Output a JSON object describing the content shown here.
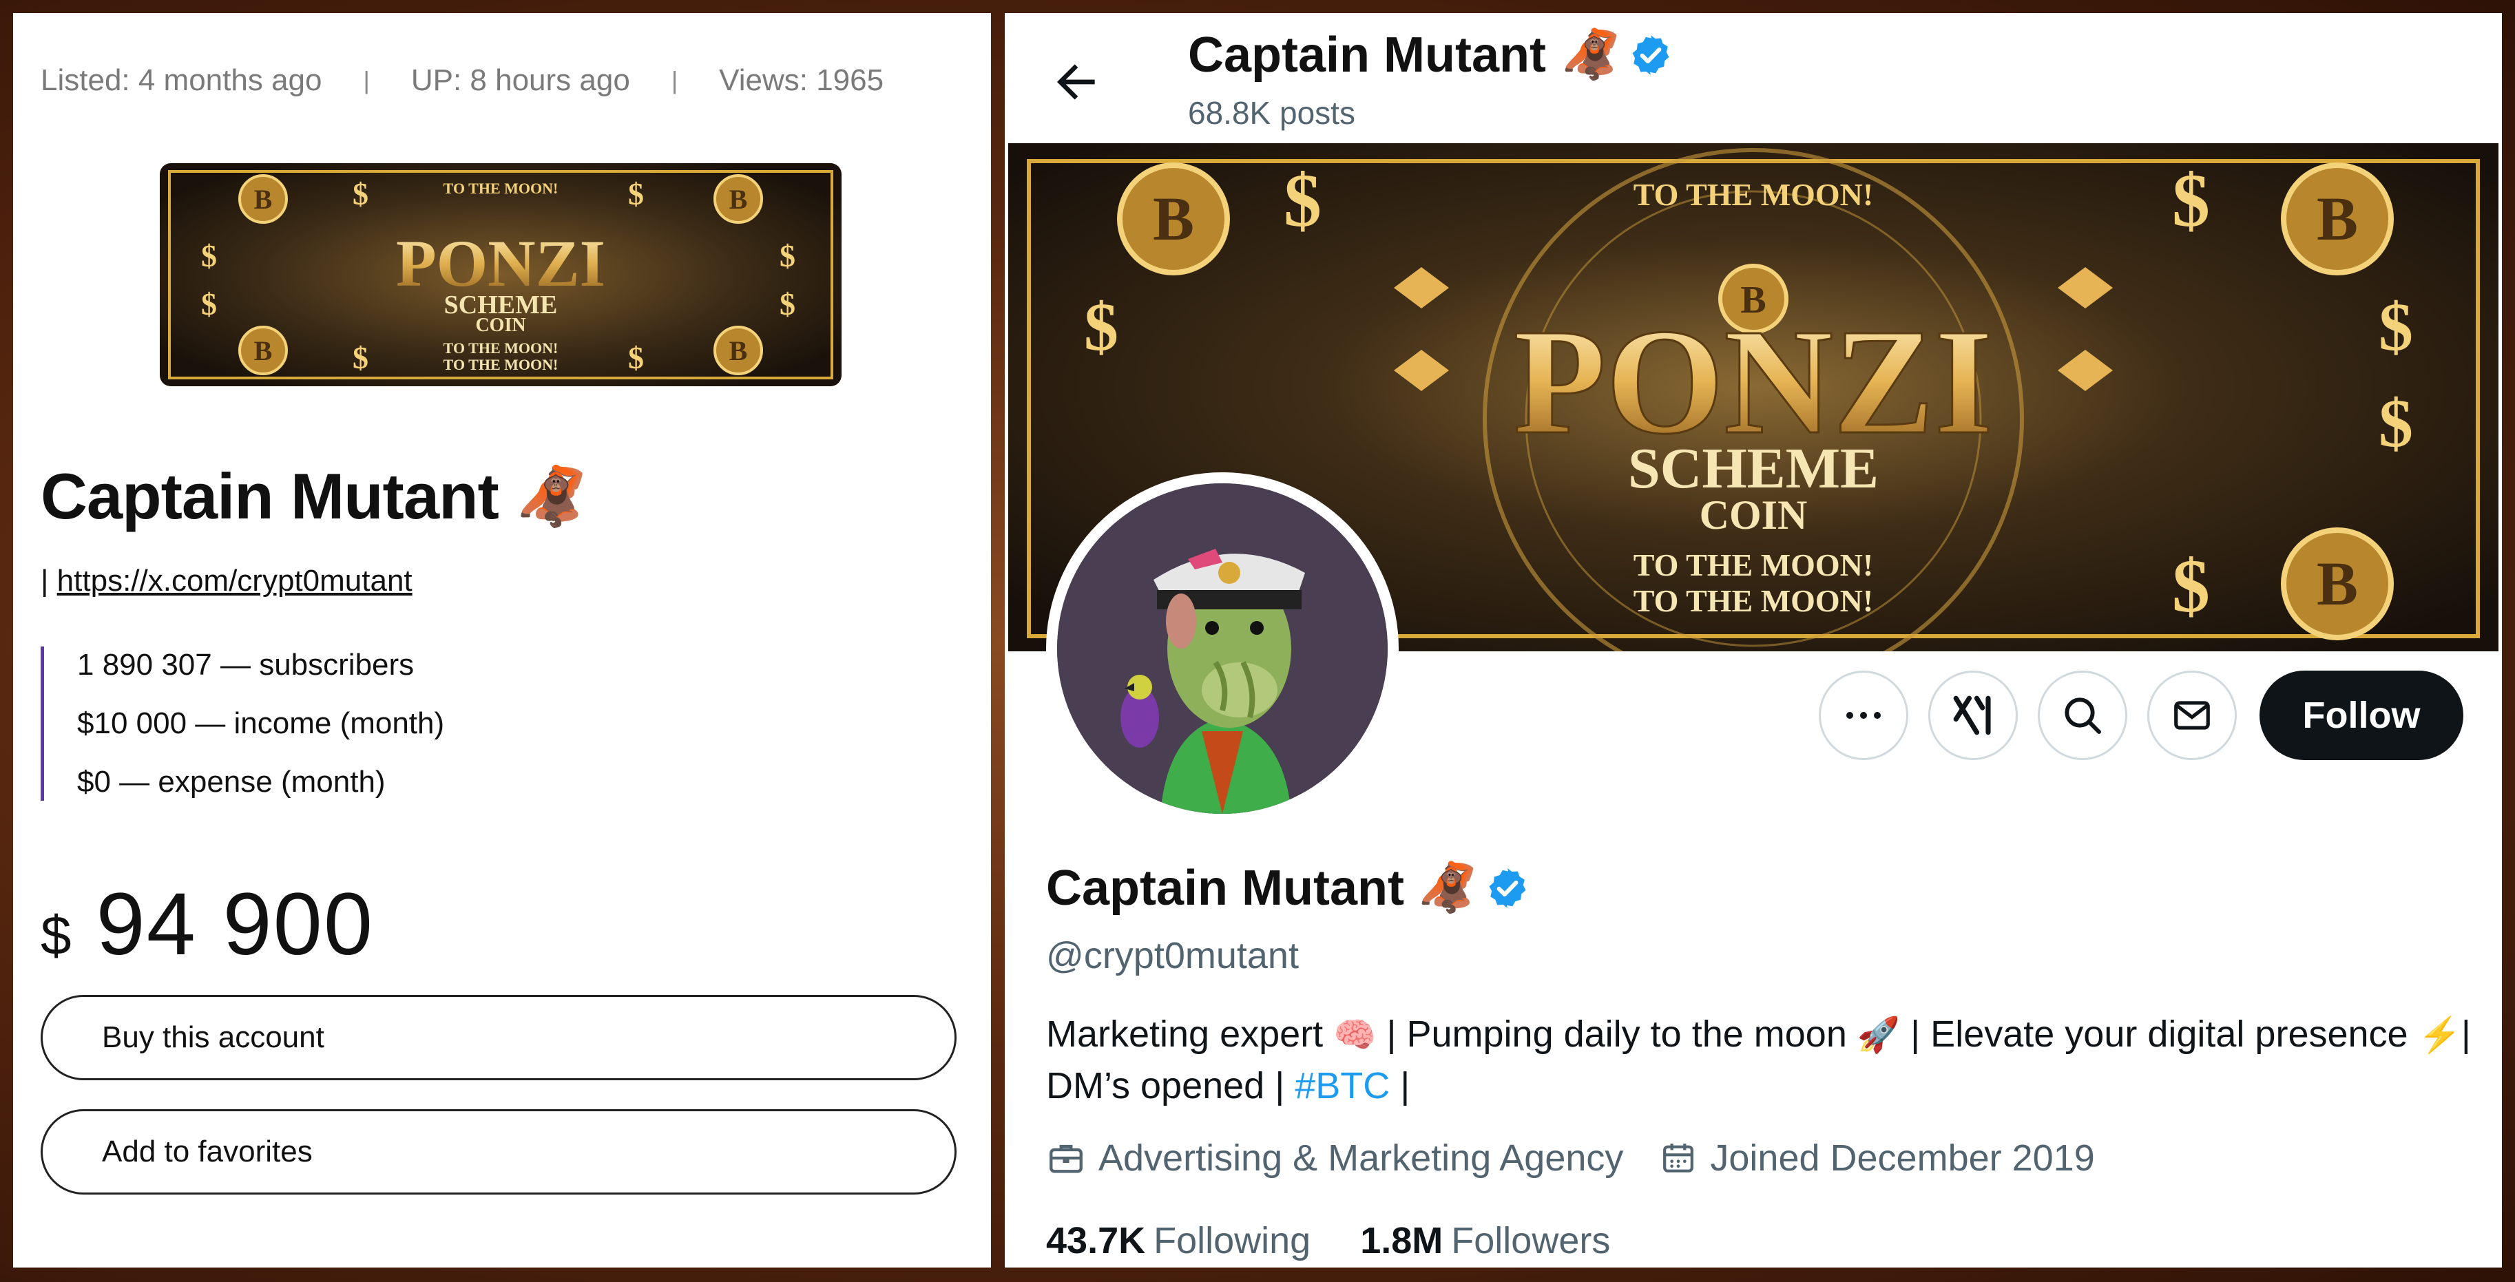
{
  "listing": {
    "listed": "Listed: 4 months ago",
    "up": "UP: 8 hours ago",
    "views": "Views: 1965",
    "separator": "|",
    "name": "Captain Mutant",
    "name_emoji": "🦧",
    "link_prefix": "|",
    "link": "https://x.com/crypt0mutant",
    "stats": [
      "1 890 307 — subscribers",
      "$10 000 — income (month)",
      "$0 — expense (month)"
    ],
    "currency": "$",
    "price": "94 900",
    "buy_label": "Buy this account",
    "fav_label": "Add to favorites"
  },
  "banner": {
    "top_text": "TO THE MOON!",
    "title": "PONZI",
    "subtitle1": "SCHEME",
    "subtitle2": "COIN",
    "bottom1": "TO THE MOON!",
    "bottom2": "TO THE MOON!",
    "dollar": "$",
    "btc": "B"
  },
  "profile": {
    "header_name": "Captain Mutant",
    "name_emoji": "🦧",
    "posts": "68.8K posts",
    "name": "Captain Mutant",
    "handle": "@crypt0mutant",
    "bio_part1": "Marketing expert ",
    "bio_emoji1": "🧠",
    "bio_part2": " | Pumping daily to the moon ",
    "bio_emoji2": "🚀",
    "bio_part3": " | Elevate your digital presence ",
    "bio_emoji3": "⚡",
    "bio_part4": "| DM’s opened | ",
    "bio_hashtag": "#BTC",
    "bio_part5": " |",
    "category": "Advertising & Marketing Agency",
    "joined": "Joined December 2019",
    "following_count": "43.7K",
    "following_label": "Following",
    "followers_count": "1.8M",
    "followers_label": "Followers",
    "follow_label": "Follow",
    "more_glyph": "•••"
  },
  "colors": {
    "verified": "#1d9bf0",
    "link_blue": "#1d9bf0",
    "follow_bg": "#0f1419",
    "stats_bar": "#5b3aa8",
    "gold": "#d9a93a"
  },
  "icons": [
    "back-arrow-icon",
    "verified-badge-icon",
    "more-icon",
    "grok-icon",
    "search-icon",
    "mail-icon",
    "briefcase-icon",
    "calendar-icon"
  ]
}
